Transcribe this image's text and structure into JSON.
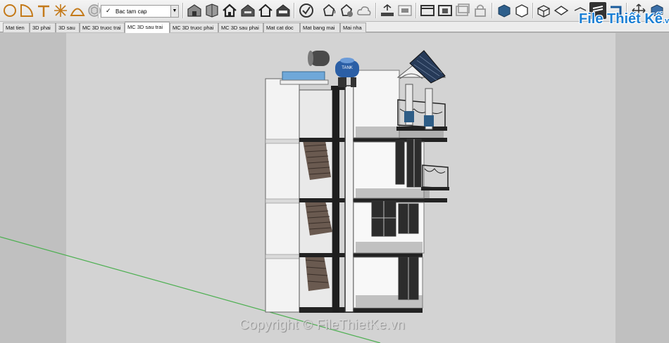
{
  "toolbar": {
    "layer_value": "Bac tam cap",
    "colors": {
      "bar_bg": "#e9e9e9",
      "icon_dark": "#3b3b3b",
      "icon_accent": "#c47a1a"
    }
  },
  "tabs": [
    {
      "label": "Mat tien",
      "active": false
    },
    {
      "label": "3D phai",
      "active": false
    },
    {
      "label": "3D sau",
      "active": false
    },
    {
      "label": "MC 3D truoc trai",
      "active": false
    },
    {
      "label": "MC 3D sau trai",
      "active": true
    },
    {
      "label": "MC 3D truoc phai",
      "active": false
    },
    {
      "label": "MC 3D sau phai",
      "active": false
    },
    {
      "label": "Mat cat doc",
      "active": false
    },
    {
      "label": "Mat bang mai",
      "active": false
    },
    {
      "label": "Mai nha",
      "active": false
    }
  ],
  "model": {
    "water_tank_label": "TANK"
  },
  "logo": {
    "text": "File Thiết Kế",
    "suffix": ".vn"
  },
  "watermark": "Copyright © FileThietKe.vn"
}
